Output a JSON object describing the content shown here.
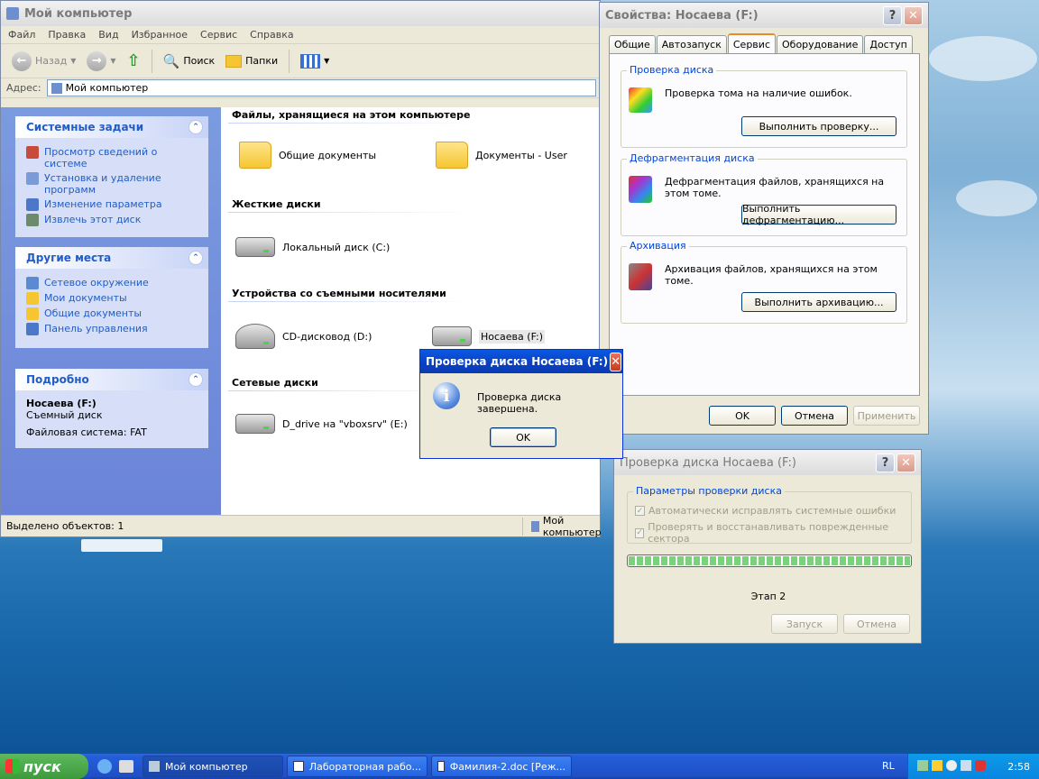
{
  "explorer": {
    "title": "Мой компьютер",
    "menu": [
      "Файл",
      "Правка",
      "Вид",
      "Избранное",
      "Сервис",
      "Справка"
    ],
    "toolbar": {
      "back": "Назад",
      "search": "Поиск",
      "folders": "Папки"
    },
    "address_label": "Адрес:",
    "address_value": "Мой компьютер",
    "panels": {
      "system_tasks": {
        "title": "Системные задачи",
        "items": [
          "Просмотр сведений о системе",
          "Установка и удаление программ",
          "Изменение параметра",
          "Извлечь этот диск"
        ]
      },
      "other_places": {
        "title": "Другие места",
        "items": [
          "Сетевое окружение",
          "Мои документы",
          "Общие документы",
          "Панель управления"
        ]
      },
      "details": {
        "title": "Подробно",
        "name": "Носаева (F:)",
        "type": "Съемный диск",
        "fs": "Файловая система: FAT"
      }
    },
    "groups": {
      "files": {
        "title": "Файлы, хранящиеся на этом компьютере",
        "items": [
          "Общие документы",
          "Документы - User"
        ]
      },
      "hard": {
        "title": "Жесткие диски",
        "items": [
          "Локальный диск (C:)"
        ]
      },
      "removable": {
        "title": "Устройства со съемными носителями",
        "items": [
          "CD-дисковод (D:)",
          "Носаева (F:)"
        ]
      },
      "network": {
        "title": "Сетевые диски",
        "items": [
          "D_drive на \"vboxsrv\" (E:)"
        ]
      }
    },
    "status_left": "Выделено объектов: 1",
    "status_right": "Мой компьютер"
  },
  "props": {
    "title": "Свойства: Носаева (F:)",
    "tabs": [
      "Общие",
      "Автозапуск",
      "Сервис",
      "Оборудование",
      "Доступ"
    ],
    "check": {
      "legend": "Проверка диска",
      "text": "Проверка тома на наличие ошибок.",
      "button": "Выполнить проверку..."
    },
    "defrag": {
      "legend": "Дефрагментация диска",
      "text": "Дефрагментация файлов, хранящихся на этом томе.",
      "button": "Выполнить дефрагментацию..."
    },
    "backup": {
      "legend": "Архивация",
      "text": "Архивация файлов, хранящихся на этом томе.",
      "button": "Выполнить архивацию..."
    },
    "ok": "OK",
    "cancel": "Отмена",
    "apply": "Применить"
  },
  "checkdlg": {
    "title": "Проверка диска Носаева (F:)",
    "legend": "Параметры проверки диска",
    "opt1": "Автоматически исправлять системные ошибки",
    "opt2": "Проверять и восстанавливать поврежденные сектора",
    "progress": 1.0,
    "stage": "Этап 2",
    "start": "Запуск",
    "cancel": "Отмена"
  },
  "msgbox": {
    "title": "Проверка диска Носаева (F:)",
    "text": "Проверка диска завершена.",
    "ok": "OK"
  },
  "taskbar": {
    "start": "пуск",
    "tasks": [
      "Мой компьютер",
      "Лабораторная рабо...",
      "Фамилия-2.doc [Реж..."
    ],
    "lang": "RL",
    "clock": "2:58"
  }
}
